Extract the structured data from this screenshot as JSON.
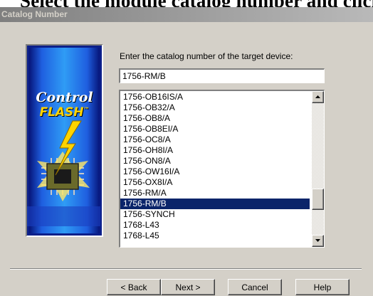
{
  "page_header": {
    "text": "Select the module catalog number and click Next"
  },
  "window": {
    "title": "Catalog Number"
  },
  "banner": {
    "line1": "Control",
    "line2": "FLASH",
    "trademark": "™"
  },
  "prompt": {
    "label": "Enter the catalog number of the target device:"
  },
  "catalog_input": {
    "value": "1756-RM/B"
  },
  "catalog_list": {
    "items": [
      "1756-OB16IS/A",
      "1756-OB32/A",
      "1756-OB8/A",
      "1756-OB8EI/A",
      "1756-OC8/A",
      "1756-OH8I/A",
      "1756-ON8/A",
      "1756-OW16I/A",
      "1756-OX8I/A",
      "1756-RM/A",
      "1756-RM/B",
      "1756-SYNCH",
      "1768-L43",
      "1768-L45"
    ],
    "selected_index": 10
  },
  "buttons": {
    "back": "< Back",
    "next": "Next >",
    "cancel": "Cancel",
    "help": "Help"
  },
  "colors": {
    "selection": "#0a246a",
    "dialog_face": "#d4d0c8",
    "banner_yellow": "#ffd400",
    "banner_blue": "#1f5fe0"
  },
  "icons": [
    "scroll-up-arrow-icon",
    "scroll-down-arrow-icon",
    "lightning-chip-icon"
  ]
}
